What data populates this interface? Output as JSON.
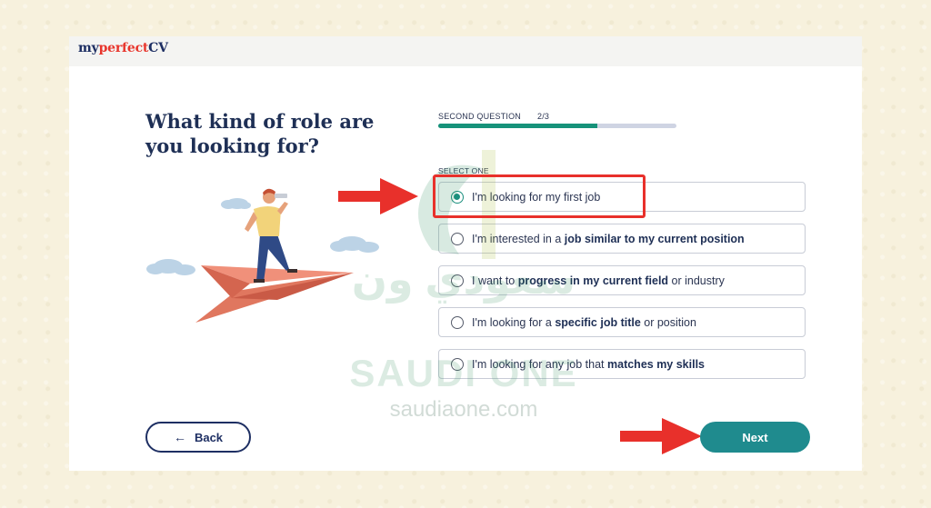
{
  "logo": {
    "part1": "my",
    "part2": "perfect",
    "part3": "CV"
  },
  "question": "What kind of role are you looking for?",
  "progress": {
    "label": "SECOND QUESTION",
    "count": "2/3",
    "fraction": 0.667
  },
  "select_label": "SELECT ONE",
  "options": [
    {
      "selected": true,
      "parts": [
        {
          "text": "I'm looking for my first job",
          "bold": false
        }
      ]
    },
    {
      "selected": false,
      "parts": [
        {
          "text": "I'm interested in a ",
          "bold": false
        },
        {
          "text": "job similar to my current position",
          "bold": true
        }
      ]
    },
    {
      "selected": false,
      "parts": [
        {
          "text": "I want to ",
          "bold": false
        },
        {
          "text": "progress in my current field",
          "bold": true
        },
        {
          "text": " or industry",
          "bold": false
        }
      ]
    },
    {
      "selected": false,
      "parts": [
        {
          "text": "I'm looking for a ",
          "bold": false
        },
        {
          "text": "specific job title",
          "bold": true
        },
        {
          "text": " or position",
          "bold": false
        }
      ]
    },
    {
      "selected": false,
      "parts": [
        {
          "text": "I'm looking for any job that ",
          "bold": false
        },
        {
          "text": "matches my skills",
          "bold": true
        }
      ]
    }
  ],
  "buttons": {
    "back": "Back",
    "next": "Next"
  },
  "watermark": {
    "arabic": "سعودي ون",
    "latin": "SAUDI ONE",
    "site": "saudiaone.com"
  },
  "colors": {
    "accent": "#1f8b8e",
    "progress": "#16927a",
    "navy": "#1e2f63",
    "annotation": "#e8302b",
    "logo_red": "#e8352c"
  },
  "icons": [
    "back-arrow-icon",
    "radio-selected-icon",
    "radio-empty-icon",
    "annotation-arrow-icon"
  ]
}
